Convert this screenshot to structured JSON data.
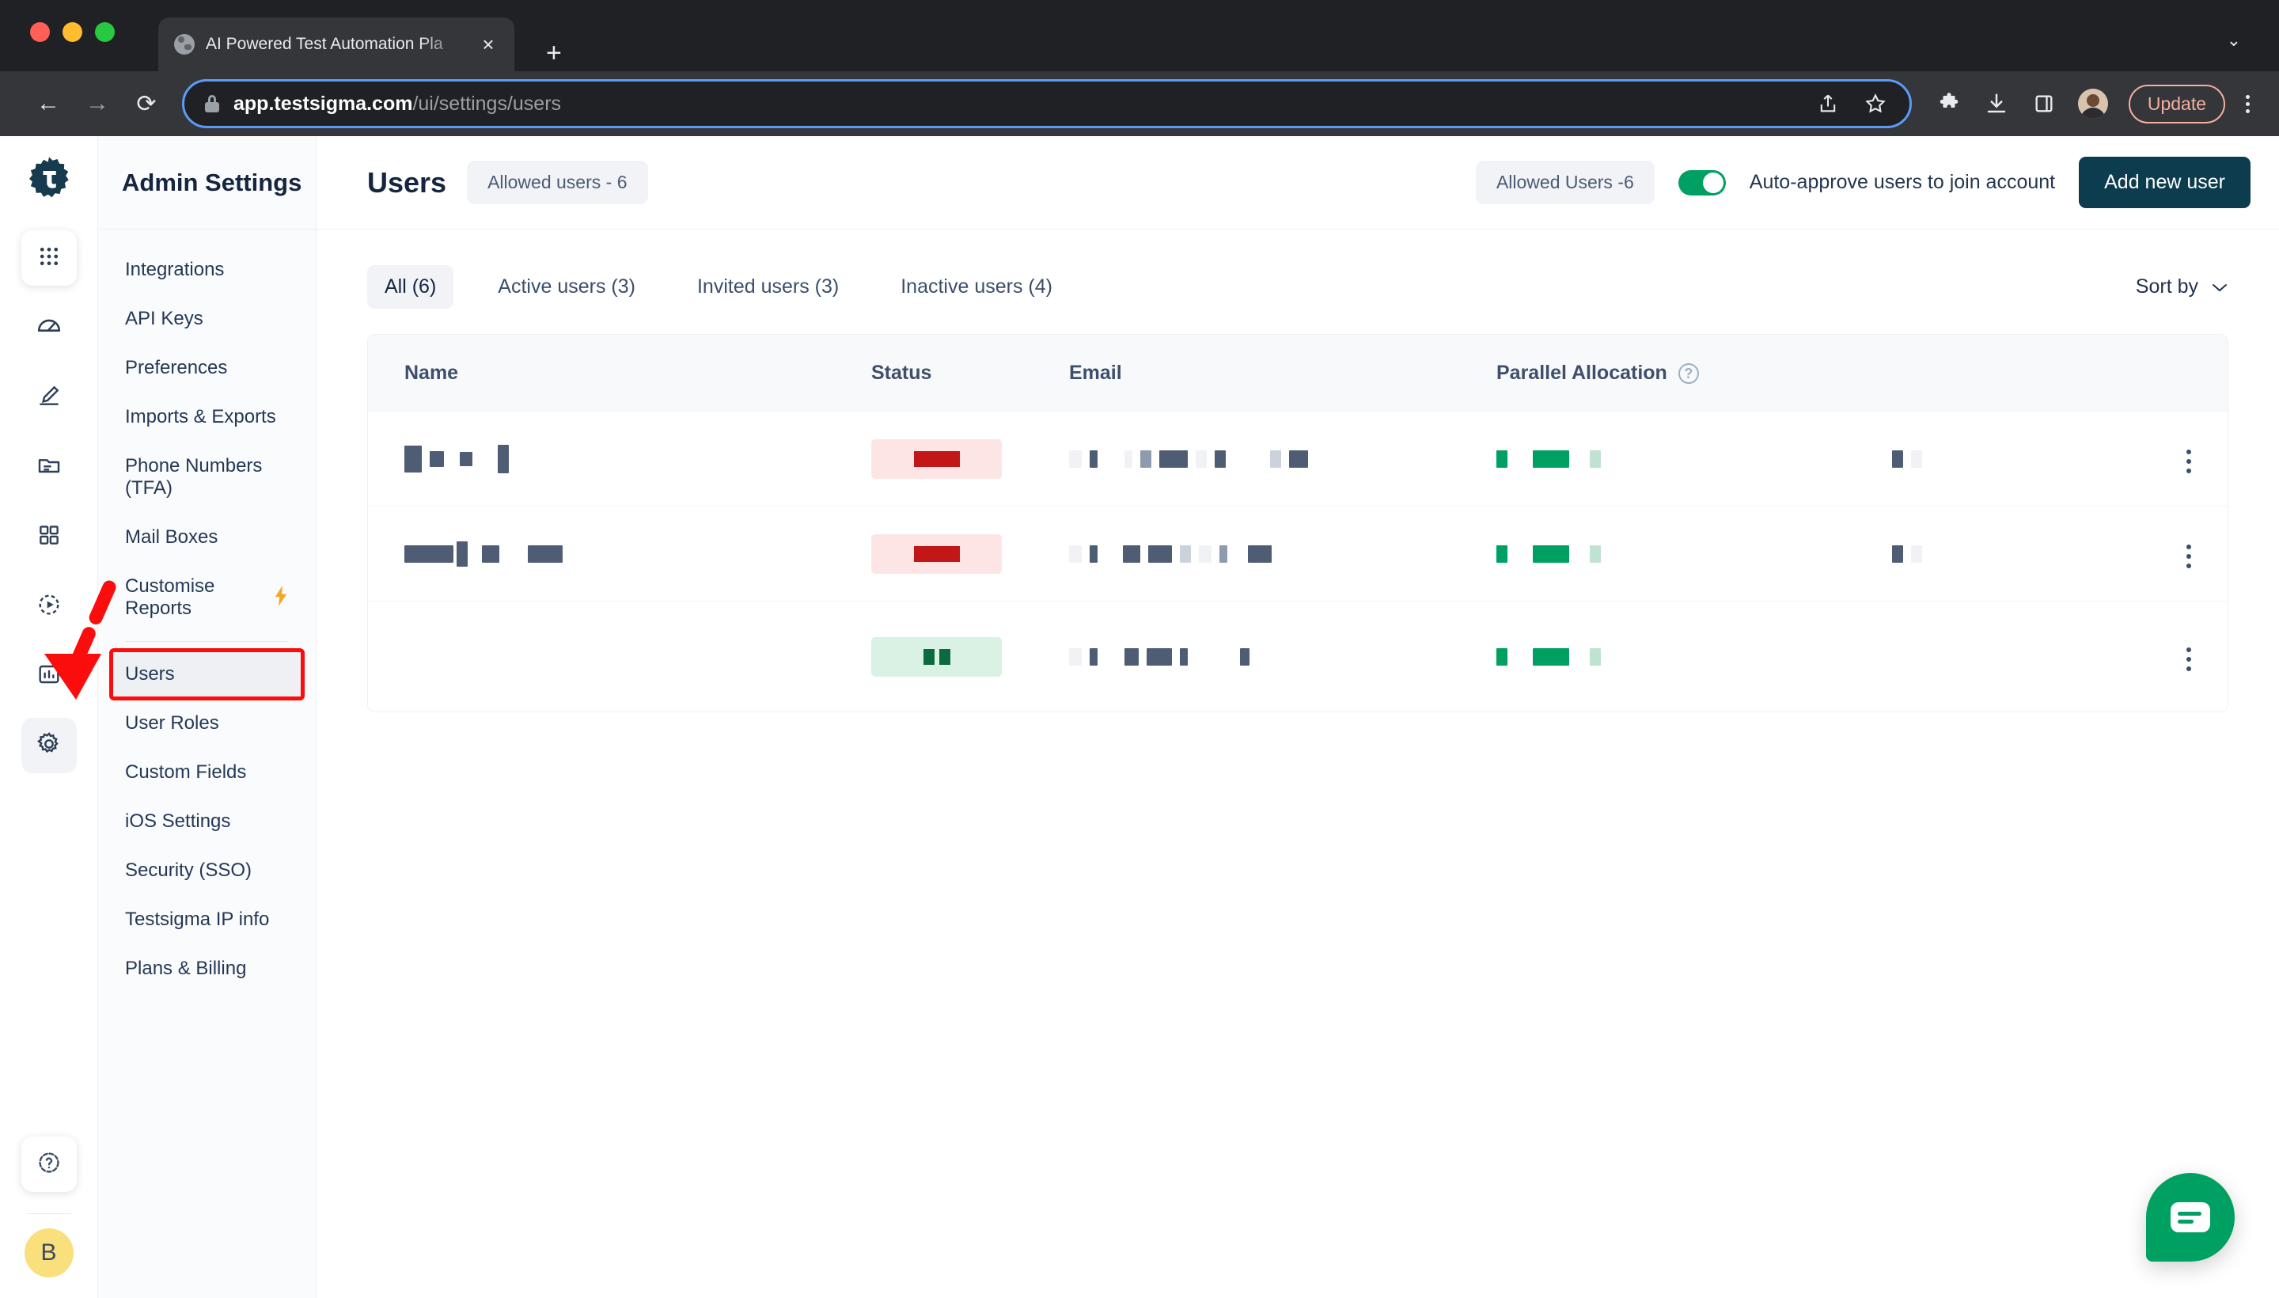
{
  "browser": {
    "tab": {
      "title": "AI Powered Test Automation Pla",
      "favicon": "globe-icon",
      "close": "×"
    },
    "new_tab": "+",
    "tabstrip_chevron": "⌄",
    "back": "←",
    "forward": "→",
    "reload": "⟳",
    "url_host": "app.testsigma.com",
    "url_path": "/ui/settings/users",
    "share_icon": "share-icon",
    "bookmark_icon": "star-icon",
    "extensions_icon": "puzzle-icon",
    "downloads_icon": "download-icon",
    "sidepanel_icon": "side-panel-icon",
    "profile_icon": "profile-avatar",
    "update_label": "Update",
    "menu_icon": "kebab-menu-icon"
  },
  "rail": {
    "logo": "testsigma-logo",
    "items": [
      {
        "name": "apps-grid-icon",
        "active": false,
        "card": true
      },
      {
        "name": "dashboard-speedometer-icon",
        "active": false,
        "card": false
      },
      {
        "name": "pencil-edit-icon",
        "active": false,
        "card": false
      },
      {
        "name": "folder-icon",
        "active": false,
        "card": false
      },
      {
        "name": "grid-squares-icon",
        "active": false,
        "card": false
      },
      {
        "name": "run-play-icon",
        "active": false,
        "card": false
      },
      {
        "name": "reports-chart-icon",
        "active": false,
        "card": false
      },
      {
        "name": "settings-gear-icon",
        "active": true,
        "card": false
      }
    ],
    "help_icon": "help-question-icon",
    "avatar_initial": "B",
    "avatar_color": "#fadf7d"
  },
  "settings_nav": {
    "title": "Admin Settings",
    "items": [
      {
        "label": "Integrations",
        "active": false,
        "bolt": false,
        "boxed": false
      },
      {
        "label": "API Keys",
        "active": false,
        "bolt": false,
        "boxed": false
      },
      {
        "label": "Preferences",
        "active": false,
        "bolt": false,
        "boxed": false
      },
      {
        "label": "Imports & Exports",
        "active": false,
        "bolt": false,
        "boxed": false
      },
      {
        "label": "Phone Numbers (TFA)",
        "active": false,
        "bolt": false,
        "boxed": false
      },
      {
        "label": "Mail Boxes",
        "active": false,
        "bolt": false,
        "boxed": false
      },
      {
        "label": "Customise Reports",
        "active": false,
        "bolt": true,
        "boxed": false
      },
      {
        "label": "Users",
        "active": true,
        "bolt": false,
        "boxed": true
      },
      {
        "label": "User Roles",
        "active": false,
        "bolt": false,
        "boxed": false
      },
      {
        "label": "Custom Fields",
        "active": false,
        "bolt": false,
        "boxed": false
      },
      {
        "label": "iOS Settings",
        "active": false,
        "bolt": false,
        "boxed": false
      },
      {
        "label": "Security (SSO)",
        "active": false,
        "bolt": false,
        "boxed": false
      },
      {
        "label": "Testsigma IP info",
        "active": false,
        "bolt": false,
        "boxed": false
      },
      {
        "label": "Plans & Billing",
        "active": false,
        "bolt": false,
        "boxed": false
      }
    ]
  },
  "page_header": {
    "title": "Users",
    "allowed_users_pill": "Allowed users - 6",
    "allowed_users_pill_right": "Allowed Users -6",
    "toggle_on": true,
    "toggle_label": "Auto-approve users to join account",
    "add_user_button": "Add new user",
    "accent_color": "#0d3c4f",
    "toggle_color": "#00a063"
  },
  "filters": {
    "tabs": [
      {
        "label": "All (6)",
        "active": true
      },
      {
        "label": "Active users (3)",
        "active": false
      },
      {
        "label": "Invited users (3)",
        "active": false
      },
      {
        "label": "Inactive users (4)",
        "active": false
      }
    ],
    "sort_by_label": "Sort by",
    "sort_by_chevron": "⌄"
  },
  "table": {
    "columns": [
      "Name",
      "Status",
      "Email",
      "Parallel Allocation"
    ],
    "parallel_allocation_help_icon": "help-circle-icon",
    "row_menu_icon": "kebab-menu-icon",
    "rows": [
      {
        "status_tone": "danger",
        "redacted": true
      },
      {
        "status_tone": "danger",
        "redacted": true
      },
      {
        "status_tone": "ok",
        "redacted": true
      }
    ]
  },
  "annotations": {
    "arrow_color": "#fb0d0d",
    "box_color": "#fb0d0d",
    "arrow_target": "settings-gear-icon",
    "box_target": "Users"
  },
  "chat_widget": {
    "icon": "chat-bubble-icon",
    "color": "#00a063"
  }
}
